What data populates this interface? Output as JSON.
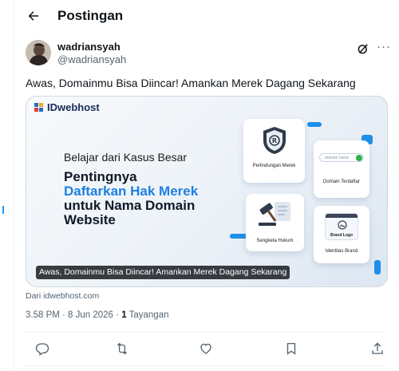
{
  "header": {
    "title": "Postingan"
  },
  "post": {
    "author_name": "wadriansyah",
    "author_handle": "@wadriansyah",
    "text": "Awas, Domainmu Bisa Diincar! Amankan Merek Dagang Sekarang",
    "timestamp": "3.58 PM · 8 Jun 2026",
    "view_count": "1",
    "view_label": "Tayangan",
    "more_glyph": "···"
  },
  "card": {
    "brand": "IDwebhost",
    "eyebrow": "Belajar dari Kasus Besar",
    "headline_line1": "Pentingnya",
    "headline_line2": "Daftarkan Hak Merek",
    "headline_line3": "untuk Nama Domain",
    "headline_line4": "Website",
    "tiles": {
      "trademark_protection": "Perlindungan Merek",
      "domain_search_placeholder": "domain name",
      "registered_domain": "Domain Terdaftar",
      "legal_dispute": "Sengketa Hukum",
      "brand_logo": "Brand Logo",
      "brand_identity": "Identitas Brand"
    },
    "caption": "Awas, Domainmu Bisa Diincar! Amankan Merek Dagang Sekarang",
    "source": "Dari idwebhost.com"
  },
  "colors": {
    "accent": "#1d9bf0",
    "text": "#0f1419",
    "muted": "#536471",
    "headline_blue": "#1e7fe0"
  },
  "actions": [
    "reply-icon",
    "repost-icon",
    "like-icon",
    "bookmark-icon",
    "share-icon"
  ]
}
